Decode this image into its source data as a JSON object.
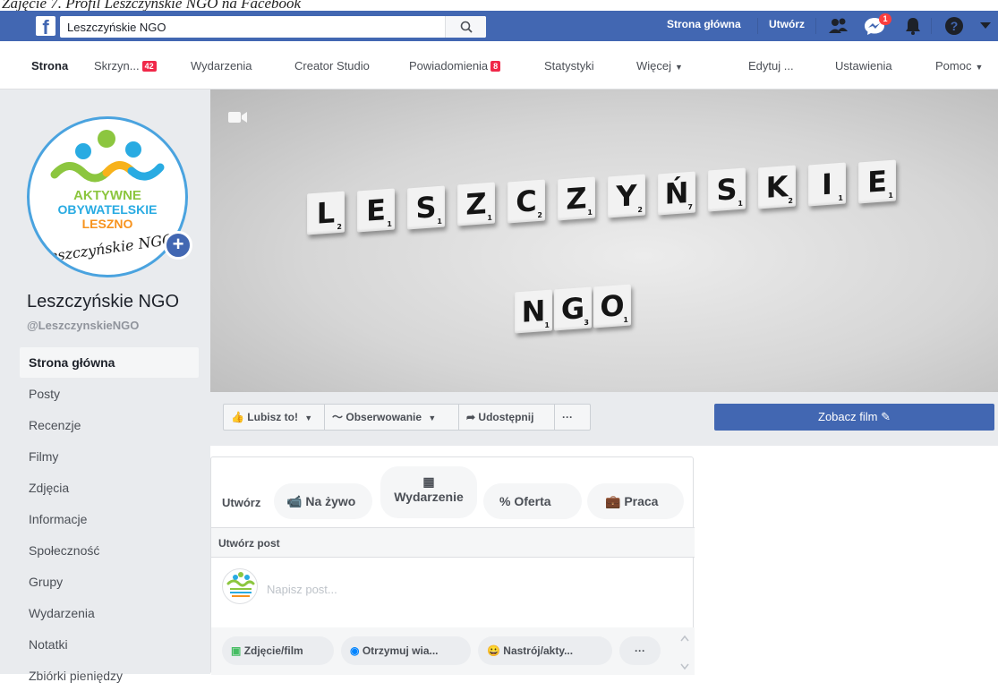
{
  "caption": "Zajęcie 7. Profil Leszczyńskie NGO na Facebook",
  "topbar": {
    "logo": "f",
    "search_value": "Leszczyńskie NGO",
    "nav_home": "Strona główna",
    "nav_create": "Utwórz",
    "messenger_badge": "1"
  },
  "page_tabs": {
    "strona": "Strona",
    "skrzynka": "Skrzyn...",
    "skrzynka_badge": "42",
    "wydarzenia": "Wydarzenia",
    "creator": "Creator Studio",
    "powiadomienia": "Powiadomienia",
    "powiadomienia_badge": "8",
    "statystyki": "Statystyki",
    "wiecej": "Więcej",
    "edytuj": "Edytuj ...",
    "ustawienia": "Ustawienia",
    "pomoc": "Pomoc"
  },
  "profile": {
    "logo_line1": "AKTYWNE",
    "logo_line2": "OBYWATELSKIE",
    "logo_line3": "LESZNO",
    "logo_script": "Leszczyńskie NGO",
    "name": "Leszczyńskie NGO",
    "handle": "@LeszczynskieNGO"
  },
  "left_menu": [
    "Strona główna",
    "Posty",
    "Recenzje",
    "Filmy",
    "Zdjęcia",
    "Informacje",
    "Społeczność",
    "Grupy",
    "Wydarzenia",
    "Notatki",
    "Zbiórki pieniędzy"
  ],
  "cover": {
    "row1": [
      {
        "l": "L",
        "n": "2"
      },
      {
        "l": "E",
        "n": "1"
      },
      {
        "l": "S",
        "n": "1"
      },
      {
        "l": "Z",
        "n": "1"
      },
      {
        "l": "C",
        "n": "2"
      },
      {
        "l": "Z",
        "n": "1"
      },
      {
        "l": "Y",
        "n": "2"
      },
      {
        "l": "Ń",
        "n": "7"
      },
      {
        "l": "S",
        "n": "1"
      },
      {
        "l": "K",
        "n": "2"
      },
      {
        "l": "I",
        "n": "1"
      },
      {
        "l": "E",
        "n": "1"
      }
    ],
    "row2": [
      {
        "l": "N",
        "n": "1"
      },
      {
        "l": "G",
        "n": "3"
      },
      {
        "l": "O",
        "n": "1"
      }
    ]
  },
  "actions": {
    "like": "Lubisz to!",
    "follow": "Obserwowanie",
    "share": "Udostępnij",
    "more": "···",
    "watch": "Zobacz film"
  },
  "composer": {
    "create_label": "Utwórz",
    "live": "Na żywo",
    "event": "Wydarzenie",
    "offer": "Oferta",
    "job": "Praca",
    "post_header": "Utwórz post",
    "placeholder": "Napisz post...",
    "photo": "Zdjęcie/film",
    "messages": "Otrzymuj wia...",
    "feeling": "Nastrój/akty...",
    "more": "···"
  },
  "colors": {
    "fb_blue": "#4267b2",
    "badge_red": "#f02849",
    "page_bg": "#e9ebee"
  }
}
